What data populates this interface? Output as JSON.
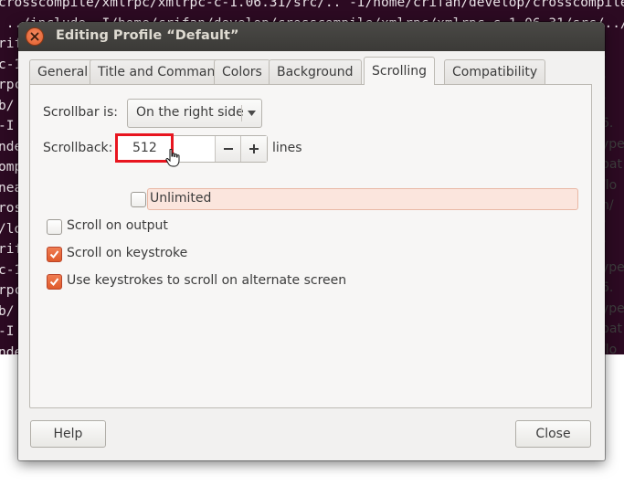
{
  "terminal": {
    "lines": [
      "crosscompile/xmlrpc/xmlrpc-c-1.06.31/src/.. -I/home/crifan/develop/crosscompile",
      " ../include -I/home/crifan/develop/crosscompile/xmlrpc/xmlrpc-c-1.06.31/src/../",
      "rif",
      "c-1",
      "rpc",
      "b/",
      "-I",
      "nde",
      "omp",
      "nea",
      "ros",
      "/lo",
      "rif",
      "c-1",
      "rpc",
      "b/",
      "-I",
      "nde",
      "omp",
      "nut",
      "rpc",
      "rpc.",
      "c-1"
    ],
    "right_lines": [
      "",
      "",
      "",
      "/",
      "/",
      "/",
      "6.",
      "ype",
      "pat",
      "/lo",
      "h/",
      "/",
      "/",
      "ype",
      "6.",
      "ype",
      "pat",
      "/lo",
      "h/",
      "ype",
      "le-",
      "1/h",
      ""
    ]
  },
  "dialog": {
    "title": "Editing Profile “Default”"
  },
  "tabs": [
    {
      "label": "General",
      "active": false
    },
    {
      "label": "Title and Command",
      "active": false
    },
    {
      "label": "Colors",
      "active": false
    },
    {
      "label": "Background",
      "active": false
    },
    {
      "label": "Scrolling",
      "active": true
    },
    {
      "label": "Compatibility",
      "active": false
    }
  ],
  "scrolling": {
    "scrollbar_label": "Scrollbar is:",
    "scrollbar_value": "On the right side",
    "scrollback_label": "Scrollback:",
    "scrollback_value": "512",
    "scrollback_unit": "lines",
    "unlimited_label": "Unlimited",
    "unlimited_checked": false,
    "scroll_on_output_label": "Scroll on output",
    "scroll_on_output_checked": false,
    "scroll_on_keystroke_label": "Scroll on keystroke",
    "scroll_on_keystroke_checked": true,
    "alt_screen_label": "Use keystrokes to scroll on alternate screen",
    "alt_screen_checked": true
  },
  "buttons": {
    "help": "Help",
    "close": "Close"
  },
  "icons": {
    "close": "close-icon",
    "dropdown": "chevron-down-icon",
    "minus": "minus-icon",
    "plus": "plus-icon",
    "check": "check-icon",
    "cursor": "hand-pointer-icon"
  },
  "colors": {
    "terminal_bg": "#2c0a22",
    "accent": "#df5a2b",
    "highlight": "#e8151f",
    "titlebar": "#3b3a37"
  }
}
